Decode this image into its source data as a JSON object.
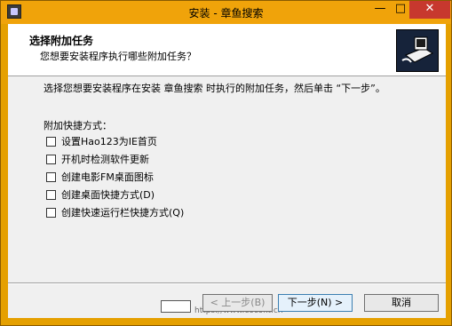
{
  "window": {
    "title": "安装 - 章鱼搜索"
  },
  "titlebar": {
    "min_glyph": "—",
    "max_glyph": "□",
    "close_glyph": "✕"
  },
  "header": {
    "title": "选择附加任务",
    "subtitle": "您想要安装程序执行哪些附加任务？"
  },
  "body": {
    "description": "选择您想要安装程序在安装 章鱼搜索 时执行的附加任务，然后单击 “下一步”。",
    "group_label": "附加快捷方式：",
    "options": [
      {
        "label": "设置Hao123为IE首页",
        "checked": false
      },
      {
        "label": "开机时检测软件更新",
        "checked": false
      },
      {
        "label": "创建电影FM桌面图标",
        "checked": false
      },
      {
        "label": "创建桌面快捷方式(D)",
        "checked": false
      },
      {
        "label": "创建快速运行栏快捷方式(Q)",
        "checked": false
      }
    ]
  },
  "buttons": {
    "back": "< 上一步(B)",
    "next": "下一步(N) >",
    "cancel": "取消"
  },
  "watermark": {
    "url": "https://www.cocokt.cn"
  },
  "colors": {
    "titlebar": "#f0a30a",
    "close": "#c7382e",
    "client": "#f0f0f0"
  }
}
